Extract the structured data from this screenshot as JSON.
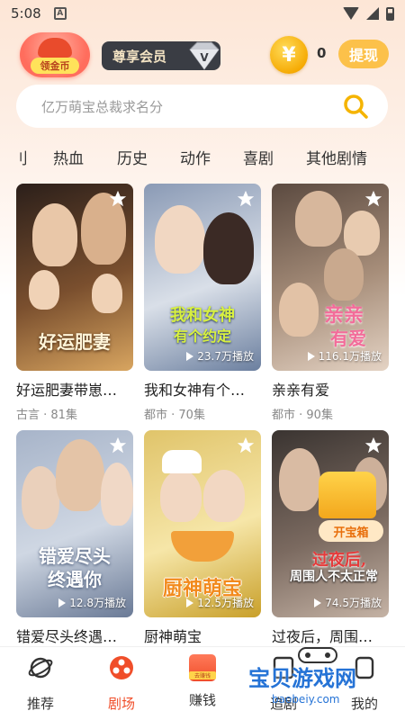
{
  "status_bar": {
    "time": "5:08",
    "notif_letter": "A"
  },
  "header": {
    "coin_badge_label": "领金币",
    "vip_label": "尊享会员",
    "vip_mark": "V",
    "coin_symbol": "¥",
    "coin_count": "0",
    "withdraw_label": "提现"
  },
  "search": {
    "placeholder": "亿万萌宝总裁求名分"
  },
  "categories": [
    "刂",
    "热血",
    "历史",
    "动作",
    "喜剧",
    "其他剧情"
  ],
  "cards": [
    {
      "title": "好运肥妻带崽…",
      "meta": "古言 · 81集",
      "plays": "",
      "poster_text": "好运肥妻",
      "poster_sub": "",
      "colors": [
        "#2b1f1a",
        "#7a4f2e",
        "#d8a560"
      ]
    },
    {
      "title": "我和女神有个…",
      "meta": "都市 · 70集",
      "plays": "23.7万播放",
      "poster_text": "我和女神",
      "poster_sub": "有个约定",
      "colors": [
        "#8a9ab5",
        "#d9dfe8",
        "#6b7f9f"
      ]
    },
    {
      "title": "亲亲有爱",
      "meta": "都市 · 90集",
      "plays": "116.1万播放",
      "poster_text": "亲亲",
      "poster_sub": "有爱",
      "colors": [
        "#5b4a40",
        "#a78e7a",
        "#e4d3c4"
      ]
    },
    {
      "title": "错爱尽头终遇…",
      "meta": "",
      "plays": "12.8万播放",
      "poster_text": "错爱尽头",
      "poster_sub": "终遇你",
      "colors": [
        "#a7b4c9",
        "#cfd7e3",
        "#6a7a96"
      ]
    },
    {
      "title": "厨神萌宝",
      "meta": "",
      "plays": "12.5万播放",
      "poster_text": "厨神萌宝",
      "poster_sub": "",
      "colors": [
        "#e0c46a",
        "#f6e6a8",
        "#c9a02a"
      ]
    },
    {
      "title": "过夜后，周围…",
      "meta": "",
      "plays": "74.5万播放",
      "poster_text": "过夜后,",
      "poster_sub": "周围人不太正常",
      "colors": [
        "#3a3431",
        "#7b6a60",
        "#c5b3a5"
      ],
      "chest_label": "开宝箱"
    }
  ],
  "bottom_nav": [
    {
      "label": "推荐",
      "icon": "planet-icon"
    },
    {
      "label": "剧场",
      "icon": "theater-icon",
      "active": true
    },
    {
      "label": "赚钱",
      "icon": "earn-icon",
      "icon_text": "去赚钱"
    },
    {
      "label": "追剧",
      "icon": "bookmark-icon"
    },
    {
      "label": "我的",
      "icon": "profile-icon"
    }
  ],
  "watermark": {
    "text": "宝贝游戏网",
    "url": "baobeiy.com"
  },
  "colors": {
    "accent": "#f04e2a",
    "gold": "#fcc14a"
  }
}
